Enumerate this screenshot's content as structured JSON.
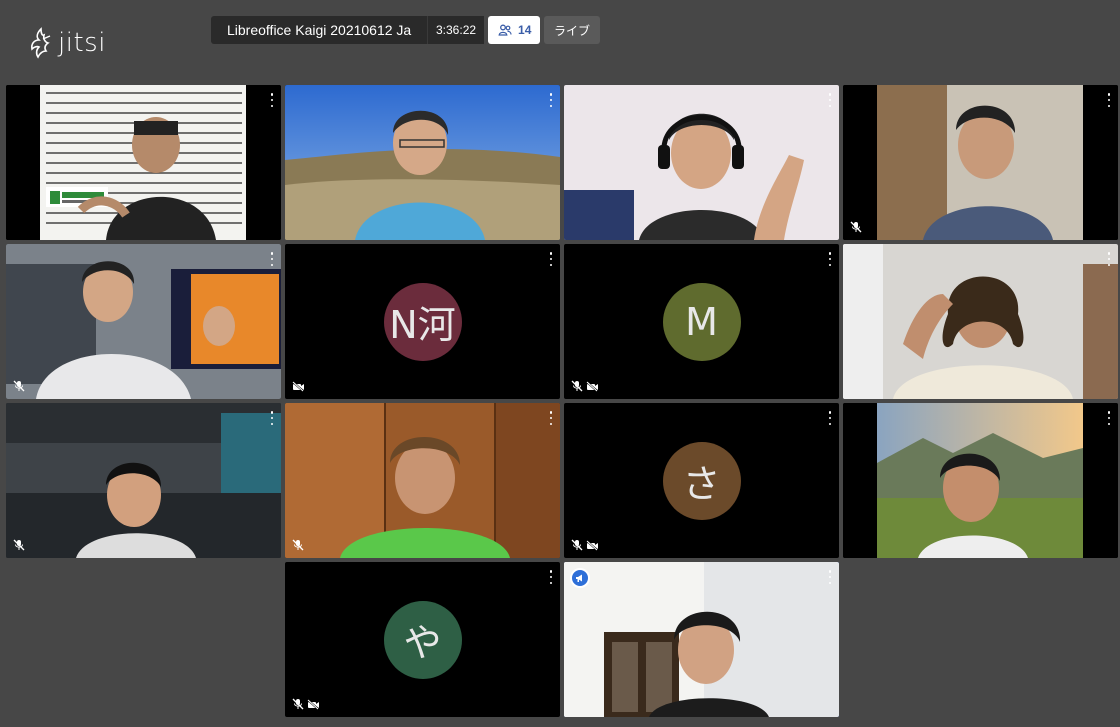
{
  "app": {
    "logo_text": "jitsi"
  },
  "header": {
    "conference_title": "Libreoffice Kaigi 20210612 Ja",
    "timer": "3:36:22",
    "participant_count": "14",
    "live_label": "ライブ"
  },
  "tiles": [
    {
      "kind": "video",
      "scene": "document-slide",
      "muted": false,
      "video_off": false
    },
    {
      "kind": "video",
      "scene": "grassland-sky",
      "muted": false,
      "video_off": false
    },
    {
      "kind": "video",
      "scene": "white-room-headset",
      "muted": false,
      "video_off": false
    },
    {
      "kind": "video",
      "scene": "office-window",
      "muted": true,
      "video_off": false
    },
    {
      "kind": "video",
      "scene": "lab-coat-monitor",
      "muted": true,
      "video_off": false
    },
    {
      "kind": "avatar",
      "initials": "N河",
      "color": "#6b2c3c",
      "muted": false,
      "video_off": true
    },
    {
      "kind": "avatar",
      "initials": "M",
      "color": "#5f6b2e",
      "muted": true,
      "video_off": true
    },
    {
      "kind": "video",
      "scene": "bright-room",
      "muted": false,
      "video_off": false
    },
    {
      "kind": "video",
      "scene": "sci-fi-room",
      "muted": true,
      "video_off": false
    },
    {
      "kind": "video",
      "scene": "wood-cabinet-green-shirt",
      "muted": true,
      "video_off": false
    },
    {
      "kind": "avatar",
      "initials": "さ",
      "color": "#6b4a2a",
      "muted": true,
      "video_off": true
    },
    {
      "kind": "video",
      "scene": "mountain-sunset",
      "muted": false,
      "video_off": false
    },
    {
      "kind": "empty"
    },
    {
      "kind": "avatar",
      "initials": "や",
      "color": "#2e5f45",
      "muted": true,
      "video_off": true
    },
    {
      "kind": "video",
      "scene": "room-bookshelf",
      "muted": false,
      "video_off": false,
      "dominant_speaker": true
    },
    {
      "kind": "empty"
    }
  ],
  "icons": {
    "participants": "people-icon",
    "menu": "more-vertical-icon",
    "mic_muted": "mic-off-icon",
    "video_off": "camera-off-icon",
    "dominant_speaker": "megaphone-icon"
  },
  "colors": {
    "background": "#474747",
    "accent": "#2e6fd8",
    "tile": "#000000"
  }
}
